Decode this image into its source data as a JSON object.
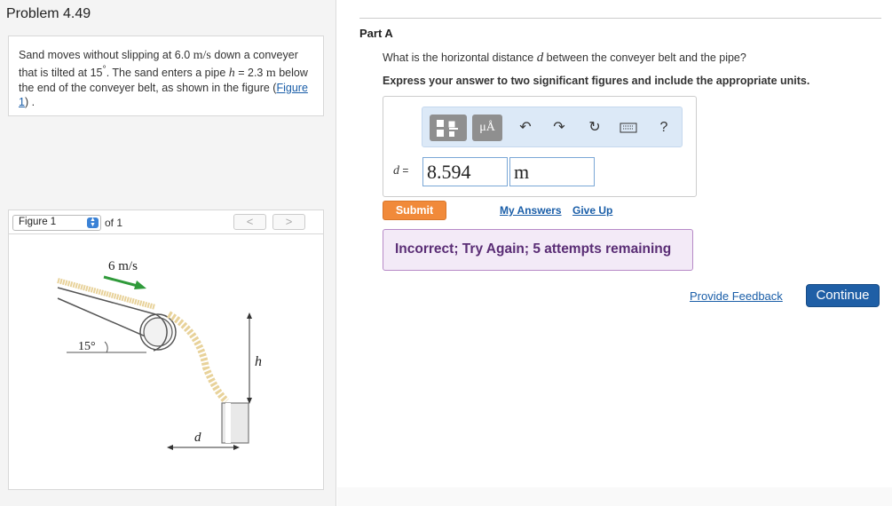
{
  "problem": {
    "title": "Problem 4.49",
    "text_1": "Sand moves without slipping at 6.0 ",
    "speed_unit": "m/s",
    "text_2": " down a conveyer that is tilted at 15",
    "degree": "°",
    "text_3": ". The sand enters a pipe ",
    "h_var": "h",
    "eq": " = ",
    "h_val": "2.3 ",
    "h_unit": "m",
    "text_4": " below the end of the conveyer belt, as shown in the figure (",
    "figure_link": "Figure 1",
    "text_5": ") ."
  },
  "figure_nav": {
    "select_value": "Figure 1",
    "of_label": "of 1",
    "prev": "<",
    "next": ">"
  },
  "figure": {
    "speed_label": "6 m/s",
    "angle_label": "15°",
    "h_label": "h",
    "d_label": "d",
    "colors": {
      "arrow": "#2f9a3a",
      "sand": "#e8d29a",
      "belt": "#555555"
    }
  },
  "part": {
    "title": "Part A",
    "question_1": "What is the horizontal distance ",
    "question_var": "d",
    "question_2": " between the conveyer belt and the pipe?",
    "instruction": "Express your answer to two significant figures and include the appropriate units."
  },
  "toolbar": {
    "units_label": "μÅ",
    "help_label": "?",
    "icons": [
      "templates-icon",
      "units-icon",
      "undo-icon",
      "redo-icon",
      "reset-icon",
      "keyboard-icon",
      "help-icon"
    ]
  },
  "answer": {
    "label_var": "d",
    "label_eq": " =",
    "value": "8.594",
    "unit": "m"
  },
  "actions": {
    "submit": "Submit",
    "my_answers": "My Answers",
    "give_up": "Give Up",
    "feedback_text": "Incorrect; Try Again; 5 attempts remaining",
    "provide_feedback": "Provide Feedback",
    "continue": "Continue"
  }
}
